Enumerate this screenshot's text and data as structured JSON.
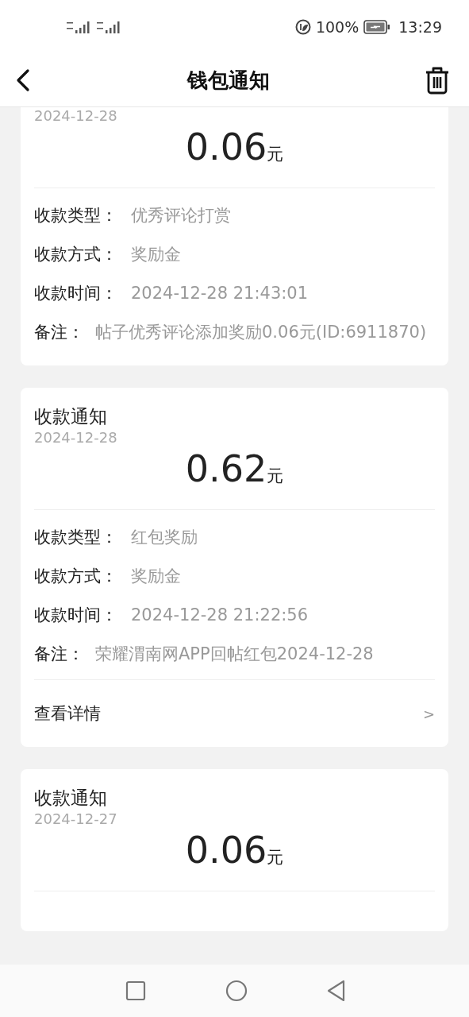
{
  "status_bar": {
    "battery": "100%",
    "time": "13:29"
  },
  "header": {
    "title": "钱包通知"
  },
  "notifications": [
    {
      "date": "2024-12-28",
      "amount": "0.06",
      "unit": "元",
      "fields": [
        {
          "label": "收款类型：",
          "value": "优秀评论打赏"
        },
        {
          "label": "收款方式：",
          "value": "奖励金"
        },
        {
          "label": "收款时间：",
          "value": "2024-12-28 21:43:01"
        }
      ],
      "remark": {
        "label": "备注：",
        "value": "帖子优秀评论添加奖励0.06元(ID:6911870)"
      }
    },
    {
      "title": "收款通知",
      "date": "2024-12-28",
      "amount": "0.62",
      "unit": "元",
      "fields": [
        {
          "label": "收款类型：",
          "value": "红包奖励"
        },
        {
          "label": "收款方式：",
          "value": "奖励金"
        },
        {
          "label": "收款时间：",
          "value": "2024-12-28 21:22:56"
        }
      ],
      "remark": {
        "label": "备注：",
        "value": "荣耀渭南网APP回帖红包2024-12-28"
      },
      "details_link": {
        "label": "查看详情",
        "arrow": ">"
      }
    },
    {
      "title": "收款通知",
      "date": "2024-12-27",
      "amount": "0.06",
      "unit": "元"
    }
  ]
}
